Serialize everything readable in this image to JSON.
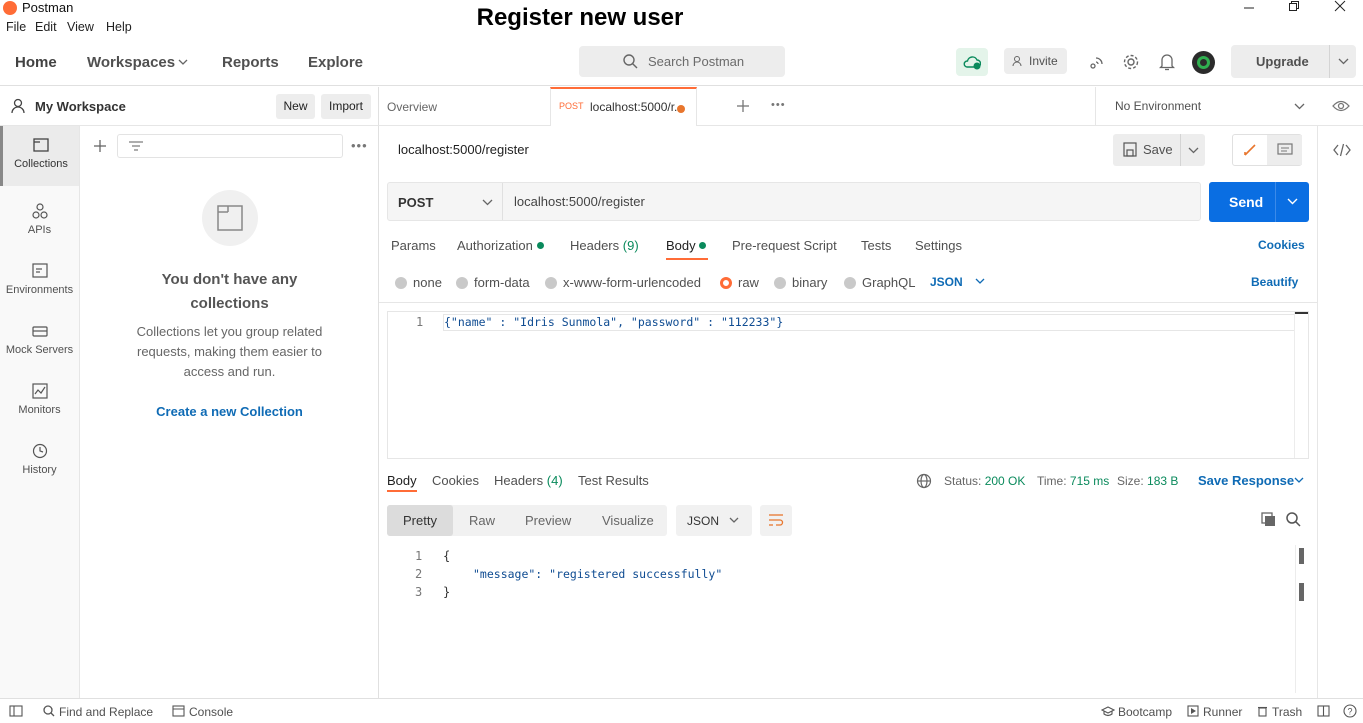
{
  "window": {
    "app_name": "Postman",
    "menus": [
      "File",
      "Edit",
      "View",
      "Help"
    ]
  },
  "overlay_title": "Register new user",
  "header": {
    "nav": [
      "Home",
      "Workspaces",
      "Reports",
      "Explore"
    ],
    "search_placeholder": "Search Postman",
    "invite": "Invite",
    "upgrade": "Upgrade"
  },
  "workspace": {
    "name": "My Workspace",
    "new": "New",
    "import": "Import"
  },
  "rail": [
    "Collections",
    "APIs",
    "Environments",
    "Mock Servers",
    "Monitors",
    "History"
  ],
  "collections_empty": {
    "title_line1": "You don't have any",
    "title_line2": "collections",
    "desc_line1": "Collections let you group related",
    "desc_line2": "requests, making them easier to",
    "desc_line3": "access and run.",
    "cta": "Create a new Collection"
  },
  "tabs": {
    "overview": "Overview",
    "active_method": "POST",
    "active_label": "localhost:5000/r...",
    "environment": "No Environment"
  },
  "request": {
    "name": "localhost:5000/register",
    "save": "Save",
    "method": "POST",
    "url": "localhost:5000/register",
    "send": "Send",
    "tabs": {
      "params": "Params",
      "authorization": "Authorization",
      "headers": "Headers",
      "headers_count": "(9)",
      "body": "Body",
      "prerequest": "Pre-request Script",
      "tests": "Tests",
      "settings": "Settings",
      "cookies": "Cookies"
    },
    "body_types": [
      "none",
      "form-data",
      "x-www-form-urlencoded",
      "raw",
      "binary",
      "GraphQL"
    ],
    "body_lang": "JSON",
    "beautify": "Beautify",
    "body_line_no": "1",
    "body_code": "{\"name\" : \"Idris Sunmola\", \"password\" : \"112233\"}"
  },
  "response": {
    "tabs": {
      "body": "Body",
      "cookies": "Cookies",
      "headers": "Headers",
      "headers_count": "(4)",
      "test_results": "Test Results"
    },
    "status_label": "Status:",
    "status_value": "200 OK",
    "time_label": "Time:",
    "time_value": "715 ms",
    "size_label": "Size:",
    "size_value": "183 B",
    "save_response": "Save Response",
    "view_modes": [
      "Pretty",
      "Raw",
      "Preview",
      "Visualize"
    ],
    "lang": "JSON",
    "lines": [
      {
        "no": "1",
        "text": "{"
      },
      {
        "no": "2",
        "text": "\"message\": \"registered successfully\""
      },
      {
        "no": "3",
        "text": "}"
      }
    ]
  },
  "statusbar": {
    "find_replace": "Find and Replace",
    "console": "Console",
    "bootcamp": "Bootcamp",
    "runner": "Runner",
    "trash": "Trash"
  },
  "colors": {
    "accent_orange": "#ff6c37",
    "send_blue": "#0a6ee2",
    "link_blue": "#0f6bb5",
    "success_green": "#0a8a5c"
  }
}
